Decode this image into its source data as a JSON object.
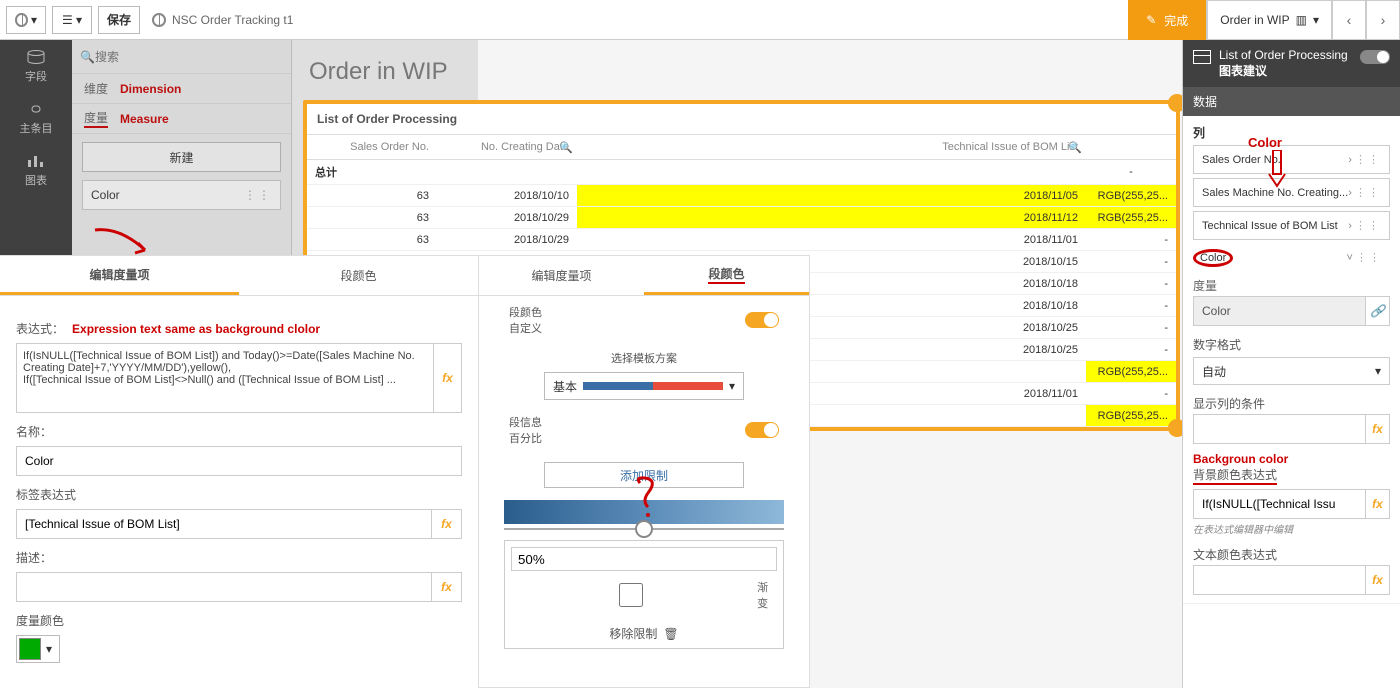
{
  "topbar": {
    "save": "保存",
    "title": "NSC Order Tracking t1",
    "done": "完成",
    "order_wip": "Order in WIP",
    "caret": "▾",
    "globe_caret": "▾",
    "list_caret": "▾"
  },
  "leftrail": {
    "fields": "字段",
    "master": "主条目",
    "charts": "图表"
  },
  "fieldspanel": {
    "search_placeholder": "搜索",
    "dimension": "维度",
    "dimension_en": "Dimension",
    "measure": "度量",
    "measure_en": "Measure",
    "new": "新建",
    "color": "Color"
  },
  "sheet": {
    "title": "Order in WIP",
    "table_title": "List of Order Processing",
    "col1": "Sales Order No.",
    "col2": "No. Creating Date",
    "col3": "Technical Issue of BOM List",
    "col4": "Color",
    "color_hand_label": "Color",
    "totals": "总计",
    "rows": [
      {
        "so": "63",
        "d1": "2018/10/10",
        "d2": "2018/11/05",
        "c": "RGB(255,25...",
        "y1": true,
        "y2": true
      },
      {
        "so": "63",
        "d1": "2018/10/29",
        "d2": "2018/11/12",
        "c": "RGB(255,25...",
        "y1": true,
        "y2": true
      },
      {
        "so": "63",
        "d1": "2018/10/29",
        "d2": "2018/11/01",
        "c": "-",
        "y1": false,
        "y2": false
      },
      {
        "so": "",
        "d1": "",
        "d2": "2018/10/15",
        "c": "-",
        "y1": false,
        "y2": false
      },
      {
        "so": "",
        "d1": "",
        "d2": "2018/10/18",
        "c": "-",
        "y1": false,
        "y2": false
      },
      {
        "so": "",
        "d1": "",
        "d2": "2018/10/18",
        "c": "-",
        "y1": false,
        "y2": false
      },
      {
        "so": "",
        "d1": "",
        "d2": "2018/10/25",
        "c": "-",
        "y1": false,
        "y2": false
      },
      {
        "so": "",
        "d1": "",
        "d2": "2018/10/25",
        "c": "-",
        "y1": false,
        "y2": false
      },
      {
        "so": "",
        "d1": "",
        "d2": "",
        "c": "RGB(255,25...",
        "y1": false,
        "y2": true
      },
      {
        "so": "",
        "d1": "",
        "d2": "2018/11/01",
        "c": "-",
        "y1": false,
        "y2": false
      },
      {
        "so": "",
        "d1": "",
        "d2": "",
        "c": "RGB(255,25...",
        "y1": false,
        "y2": true
      }
    ]
  },
  "modal_left": {
    "tab1": "编辑度量项",
    "tab2": "段颜色",
    "expr_label": "表达式：",
    "expr_note": "Expression text same as background clolor",
    "expr_value": "If(IsNULL([Technical Issue of BOM List]) and Today()>=Date([Sales Machine No. Creating Date]+7,'YYYY/MM/DD'),yellow(),\nIf([Technical Issue of BOM List]<>Null() and ([Technical Issue of BOM List] ...",
    "name_label": "名称：",
    "name_value": "Color",
    "label_expr_label": "标签表达式",
    "label_expr_value": "[Technical Issue of BOM List]",
    "desc_label": "描述：",
    "measure_color_label": "度量颜色"
  },
  "modal_center": {
    "tab1": "编辑度量项",
    "tab2": "段颜色",
    "seg_color": "段颜色",
    "custom": "自定义",
    "scheme_label": "选择模板方案",
    "scheme_value": "基本",
    "seg_info": "段信息",
    "percent": "百分比",
    "add_limit": "添加限制",
    "pct_value": "50%",
    "gradient": "渐变",
    "move_limit": "移除限制"
  },
  "rpanel": {
    "title1": "List of Order Processing",
    "title2": "图表建议",
    "tab": "数据",
    "columns": "列",
    "f1": "Sales Order No.",
    "f2": "Sales Machine No. Creating...",
    "f3": "Technical Issue of BOM List",
    "f4": "Color",
    "measure": "度量",
    "color_ph": "Color",
    "num_format": "数字格式",
    "auto": "自动",
    "show_cond": "显示列的条件",
    "bg_note": "Backgroun color",
    "bg_expr": "背景颜色表达式",
    "bg_val": "If(IsNULL([Technical Issu",
    "bg_hint": "在表达式编辑器中编辑",
    "txt_expr": "文本颜色表达式"
  },
  "icons": {
    "pencil": "✎",
    "chart": "⬍",
    "prev": "‹",
    "next": "›",
    "search": "🔍",
    "link": "🔗",
    "trash": "🗑",
    "caret_down": "▾",
    "chevron_right": "›",
    "drag": "⋮⋮"
  }
}
